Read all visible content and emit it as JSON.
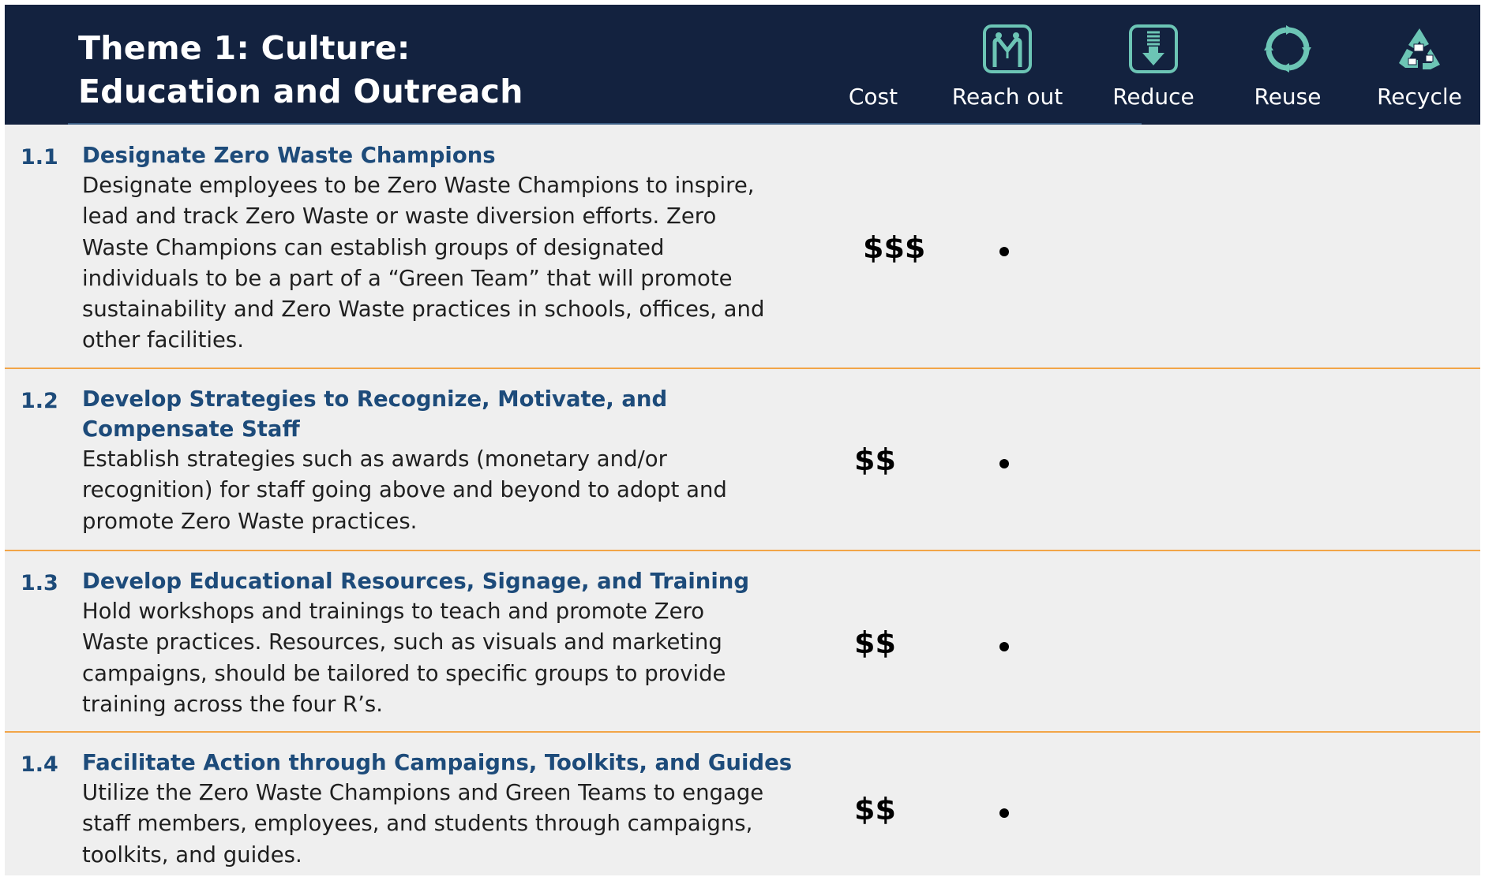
{
  "header": {
    "title_line1": "Theme 1: Culture:",
    "title_line2": "Education and Outreach",
    "columns": [
      {
        "label": "Cost",
        "icon": "none"
      },
      {
        "label": "Reach out",
        "icon": "reach-out-icon"
      },
      {
        "label": "Reduce",
        "icon": "reduce-icon"
      },
      {
        "label": "Reuse",
        "icon": "reuse-icon"
      },
      {
        "label": "Recycle",
        "icon": "recycle-icon"
      }
    ]
  },
  "colors": {
    "header_bg": "#13223f",
    "icon_teal": "#6cc5b5",
    "heading_blue": "#1d4b7a",
    "divider_orange": "#f2a548",
    "row_bg": "#efefef"
  },
  "rows": [
    {
      "number": "1.1",
      "heading_lines": [
        "Designate Zero Waste Champions"
      ],
      "desc_lines": [
        "Designate employees to be Zero Waste Champions to inspire,",
        "lead and track Zero Waste or waste diversion efforts. Zero",
        "Waste Champions can establish groups of designated",
        "individuals to be a part of a “Green Team” that will promote",
        "sustainability and Zero Waste practices in schools, offices, and",
        "other facilities."
      ],
      "cost": "$$$",
      "reach_out": "•"
    },
    {
      "number": "1.2",
      "heading_lines": [
        "Develop Strategies to Recognize, Motivate, and",
        "Compensate Staff"
      ],
      "desc_lines": [
        "Establish strategies such as awards (monetary and/or",
        "recognition) for staff going above and beyond to adopt and",
        "promote Zero Waste practices."
      ],
      "cost": "$$",
      "reach_out": "•"
    },
    {
      "number": "1.3",
      "heading_lines": [
        "Develop Educational Resources, Signage, and Training"
      ],
      "desc_lines": [
        "Hold workshops and trainings to teach and promote Zero",
        "Waste practices. Resources, such as visuals and marketing",
        "campaigns, should be tailored to specific groups to provide",
        "training across the four R’s."
      ],
      "cost": "$$",
      "reach_out": "•"
    },
    {
      "number": "1.4",
      "heading_lines": [
        "Facilitate Action through Campaigns, Toolkits, and Guides"
      ],
      "desc_lines": [
        "Utilize the Zero Waste Champions and Green Teams to engage",
        "staff members, employees, and students through campaigns,",
        "toolkits, and guides."
      ],
      "cost": "$$",
      "reach_out": "•"
    }
  ]
}
